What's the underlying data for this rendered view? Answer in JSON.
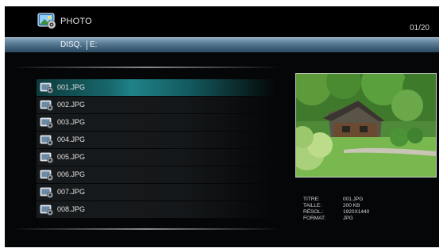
{
  "header": {
    "title": "PHOTO",
    "page_count": "01/20"
  },
  "pathbar": {
    "label": "DISQ.",
    "value": "E:"
  },
  "files": [
    {
      "name": "001.JPG",
      "selected": true
    },
    {
      "name": "002.JPG",
      "selected": false
    },
    {
      "name": "003.JPG",
      "selected": false
    },
    {
      "name": "004.JPG",
      "selected": false
    },
    {
      "name": "005.JPG",
      "selected": false
    },
    {
      "name": "006.JPG",
      "selected": false
    },
    {
      "name": "007.JPG",
      "selected": false
    },
    {
      "name": "008.JPG",
      "selected": false
    }
  ],
  "info": {
    "title_label": "TITRE:",
    "title_value": "001.JPG",
    "size_label": "TAILLE:",
    "size_value": "200 KB",
    "res_label": "RÉSOL.:",
    "res_value": "1920X1440",
    "format_label": "FORMAT:",
    "format_value": "JPG"
  },
  "icons": {
    "app": "photo-app-icon",
    "file": "image-file-icon"
  },
  "colors": {
    "background": "#050607",
    "selection": "#1e8288",
    "pathbar": "#4d6f88"
  }
}
